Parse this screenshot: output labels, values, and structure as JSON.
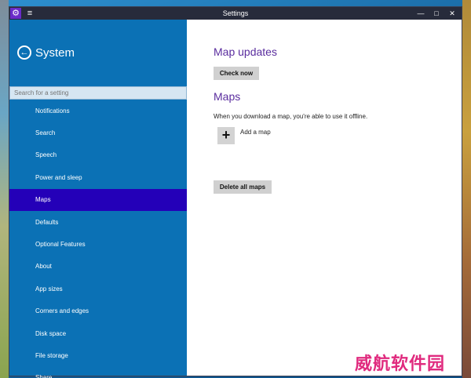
{
  "window": {
    "title": "Settings",
    "hamburger": "≡",
    "app_icon": "⚙",
    "minimize": "—",
    "maximize": "□",
    "close": "✕"
  },
  "sidebar": {
    "back_icon": "←",
    "section_title": "System",
    "search_placeholder": "Search for a setting",
    "items": [
      {
        "label": "Notifications"
      },
      {
        "label": "Search"
      },
      {
        "label": "Speech"
      },
      {
        "label": "Power and sleep"
      },
      {
        "label": "Maps",
        "selected": true
      },
      {
        "label": "Defaults"
      },
      {
        "label": "Optional Features"
      },
      {
        "label": "About"
      },
      {
        "label": "App sizes"
      },
      {
        "label": "Corners and edges"
      },
      {
        "label": "Disk space"
      },
      {
        "label": "File storage"
      },
      {
        "label": "Share"
      }
    ]
  },
  "content": {
    "map_updates_heading": "Map updates",
    "check_now_label": "Check now",
    "maps_heading": "Maps",
    "description": "When you download a map, you're able to use it offline.",
    "add_map_icon": "+",
    "add_map_label": "Add a map",
    "delete_all_label": "Delete all maps"
  },
  "watermark": "威航软件园",
  "colors": {
    "sidebar": "#0b71b5",
    "selected": "#2400b8",
    "heading": "#5a2d9e",
    "titlebar": "#272b3b"
  }
}
